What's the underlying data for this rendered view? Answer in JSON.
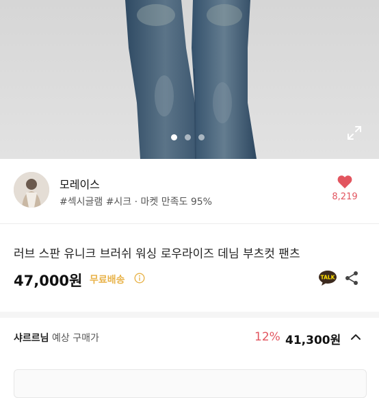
{
  "gallery": {
    "image_alt": "denim bootcut pants photo",
    "dot_count": 3,
    "active_dot": 1,
    "expand_icon": "expand-icon"
  },
  "seller": {
    "name": "모레이스",
    "meta": "#섹시글램 #시크 · 마켓 만족도 95%",
    "like_count": "8,219",
    "like_icon": "heart-icon"
  },
  "product": {
    "title": "러브 스판 유니크 브러쉬 워싱 로우라이즈 데님 부츠컷 팬츠",
    "price": "47,000원",
    "shipping": "무료배송",
    "info_icon": "info-icon",
    "talk_icon": "kakao-talk-icon",
    "talk_label": "TALK",
    "share_icon": "share-icon"
  },
  "member_price": {
    "member_name": "샤르르님",
    "label": "예상 구매가",
    "discount": "12%",
    "final_price": "41,300원",
    "toggle_icon": "chevron-up-icon"
  },
  "colors": {
    "accent_red": "#e2555f",
    "shipping_gold": "#e8b34a",
    "talk_yellow": "#ffe000"
  }
}
